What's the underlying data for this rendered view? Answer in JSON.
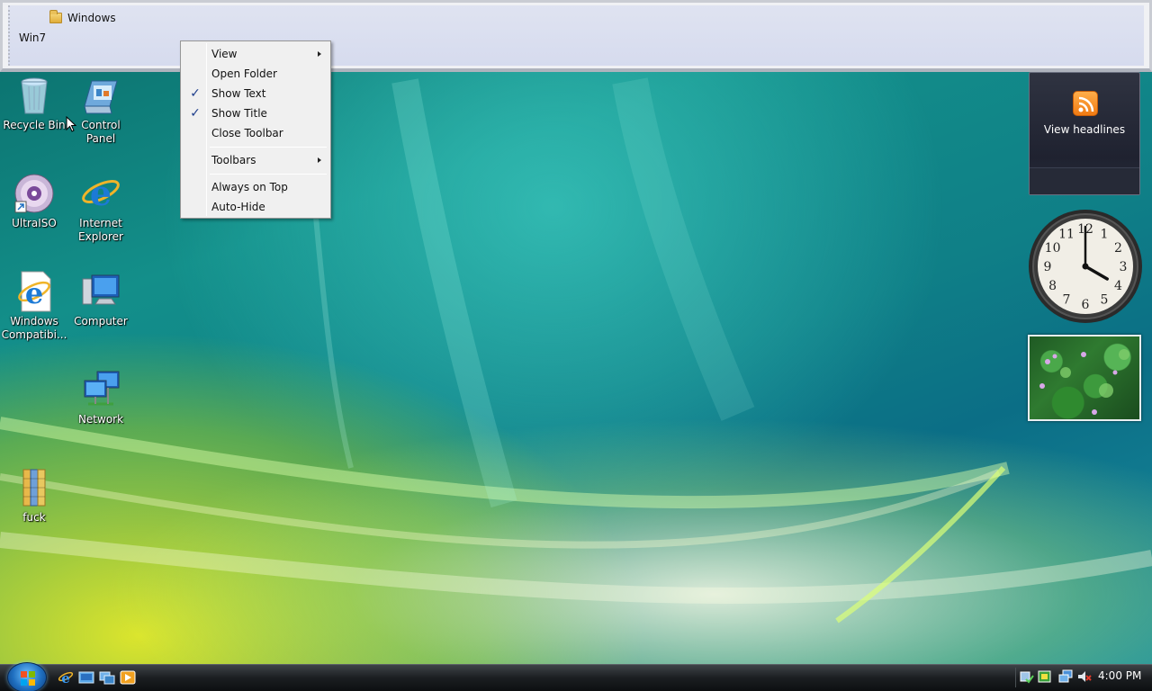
{
  "toolbar": {
    "folder_label": "Windows",
    "title": "Win7"
  },
  "context_menu": {
    "items": [
      {
        "label": "View",
        "checked": false,
        "submenu": true
      },
      {
        "label": "Open Folder",
        "checked": false,
        "submenu": false
      },
      {
        "label": "Show Text",
        "checked": true,
        "submenu": false
      },
      {
        "label": "Show Title",
        "checked": true,
        "submenu": false
      },
      {
        "label": "Close Toolbar",
        "checked": false,
        "submenu": false
      },
      {
        "label": "Toolbars",
        "checked": false,
        "submenu": true
      },
      {
        "label": "Always on Top",
        "checked": false,
        "submenu": false
      },
      {
        "label": "Auto-Hide",
        "checked": false,
        "submenu": false
      }
    ],
    "check_glyph": "✓"
  },
  "desktop": {
    "icons": [
      {
        "label": "Recycle Bin",
        "icon": "recycle-bin-icon"
      },
      {
        "label": "Control Panel",
        "icon": "control-panel-icon"
      },
      {
        "label": "UltraISO",
        "icon": "ultraiso-icon"
      },
      {
        "label": "Internet Explorer",
        "icon": "internet-explorer-icon"
      },
      {
        "label": "Windows Compatibi...",
        "icon": "windows-compatibility-icon"
      },
      {
        "label": "Computer",
        "icon": "computer-icon"
      },
      {
        "label": "Network",
        "icon": "network-icon"
      },
      {
        "label": "fuck",
        "icon": "archive-icon"
      }
    ]
  },
  "gadgets": {
    "rss": {
      "label": "View headlines"
    },
    "clock": {
      "numerals": [
        "12",
        "1",
        "2",
        "3",
        "4",
        "5",
        "6",
        "7",
        "8",
        "9",
        "10",
        "11"
      ],
      "hour": 4,
      "minute": 0
    }
  },
  "taskbar": {
    "time": "4:00 PM"
  },
  "colors": {
    "accent": "#1f6fc0",
    "rss_orange": "#f07a12"
  }
}
